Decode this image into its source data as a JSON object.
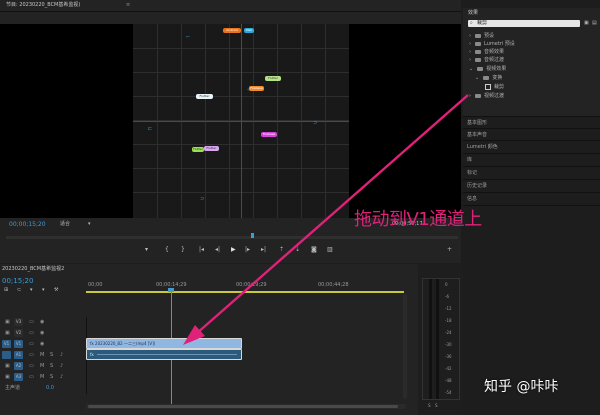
{
  "program_monitor": {
    "tab_title": "节目: 20230220_BCM基希监视)",
    "timecode_left": "00;00;15;20",
    "fit_dropdown": "适合",
    "timecode_right": "00;00;56;17",
    "video_tags": {
      "top_orange": "Android",
      "top_blue": "Web",
      "orange": "Firebase",
      "green": "Flutter",
      "white": "Flutter",
      "purple": "Firebase",
      "green2": "Flutter",
      "purple2": "Flutter"
    }
  },
  "effects_panel": {
    "title": "效果",
    "search_value": "裁剪",
    "items": [
      "预设",
      "Lumetri 预设",
      "音频效果",
      "音频过渡",
      "视频效果",
      "变换",
      "裁剪",
      "视频过渡"
    ]
  },
  "side_panels": [
    "基本图形",
    "基本声音",
    "Lumetri 颜色",
    "库",
    "标记",
    "历史记录",
    "信息"
  ],
  "annotation": {
    "text": "拖动到V1通道上"
  },
  "timeline": {
    "tab_title": "20230220_BCM基希监视2",
    "timecode": "00;15;20",
    "ruler": [
      "00;00",
      "00;00;14;29",
      "00;00;29;29",
      "00;00;44;28"
    ],
    "video_tracks": [
      "V3",
      "V2",
      "V1"
    ],
    "audio_tracks": [
      "A1",
      "A2",
      "A3"
    ],
    "mix_label": "主声道",
    "mix_value": "0.0",
    "source_label": "V1",
    "video_clip_label": "fx  20230220_B2 一二三(mp4 [V])",
    "audio_clip_label": "fx"
  },
  "meter": {
    "labels": [
      "0",
      "-6",
      "-12",
      "-18",
      "-24",
      "-30",
      "-36",
      "-42",
      "-48",
      "-54"
    ],
    "bottom": [
      "S",
      "S"
    ]
  },
  "watermark": "知乎 @咔咔"
}
